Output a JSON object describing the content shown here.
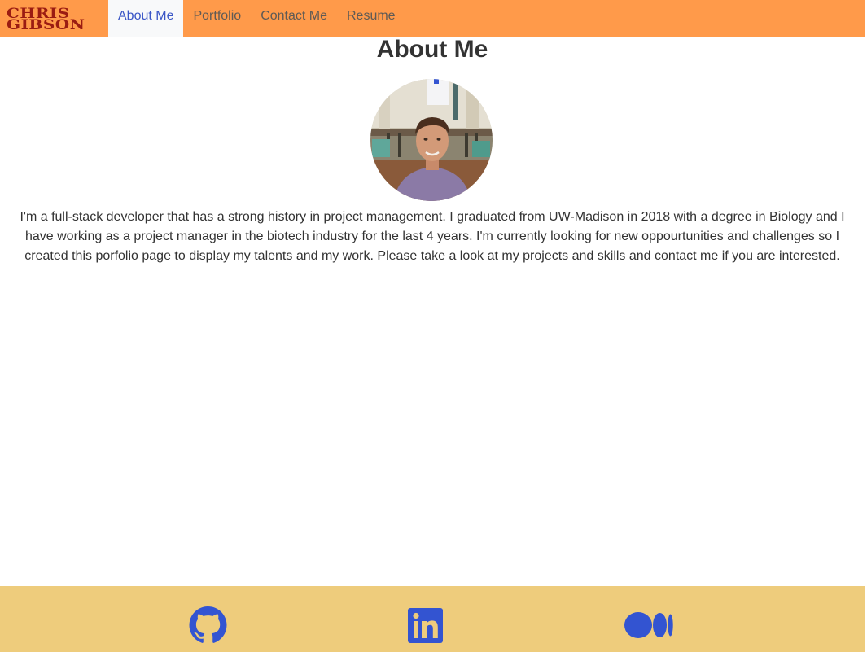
{
  "brand": {
    "line1": "CHRIS",
    "line2": "GIBSON"
  },
  "nav": {
    "items": [
      {
        "label": "About Me",
        "active": true
      },
      {
        "label": "Portfolio",
        "active": false
      },
      {
        "label": "Contact Me",
        "active": false
      },
      {
        "label": "Resume",
        "active": false
      }
    ]
  },
  "main": {
    "title": "About Me",
    "bio": "I'm a full-stack developer that has a strong history in project management. I graduated from UW-Madison in 2018 with a degree in Biology and I have working as a project manager in the biotech industry for the last 4 years. I'm currently looking for new oppourtunities and challenges so I created this porfolio page to display my talents and my work. Please take a look at my projects and skills and contact me if you are interested."
  },
  "footer": {
    "links": [
      {
        "icon": "github-icon"
      },
      {
        "icon": "linkedin-icon"
      },
      {
        "icon": "medium-icon"
      }
    ]
  },
  "colors": {
    "navbar": "#ff9a4a",
    "brand": "#9b1c12",
    "active_link": "#3a56c6",
    "footer": "#eecc7c",
    "icons": "#3354d1"
  }
}
